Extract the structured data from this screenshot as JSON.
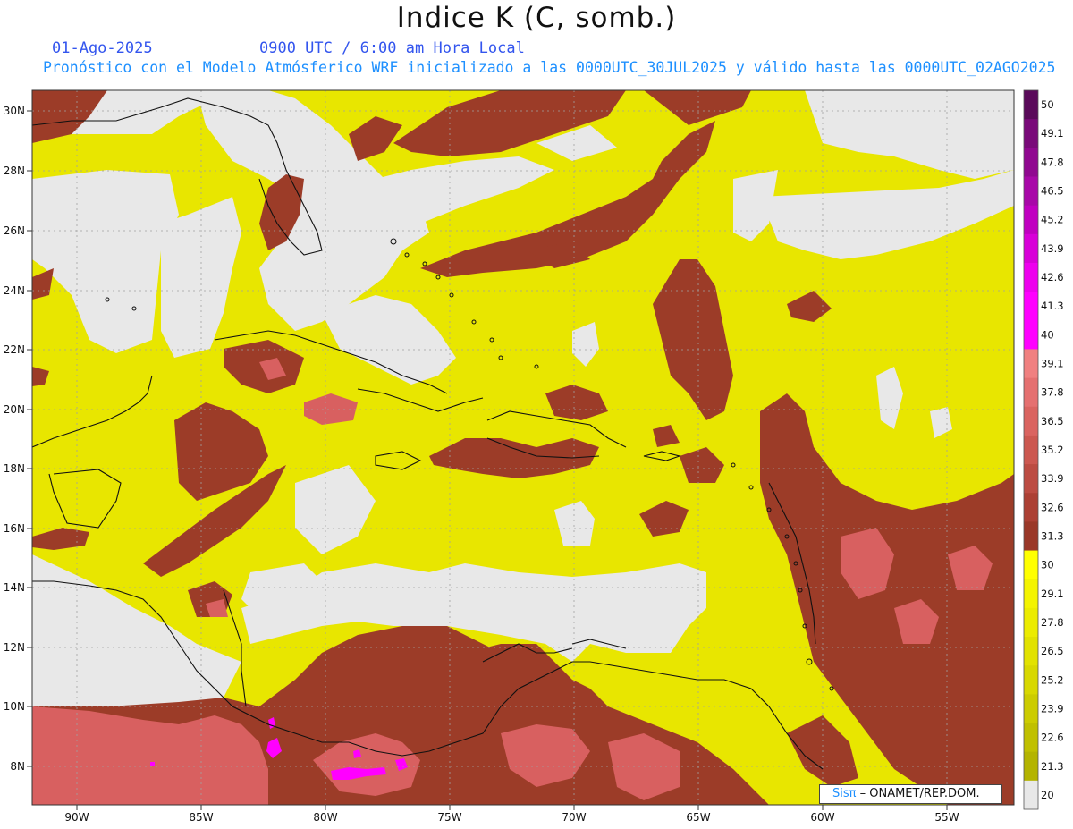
{
  "header": {
    "title": "Indice K (C, somb.)",
    "date": "01-Ago-2025",
    "time": "0900 UTC / 6:00 am Hora Local",
    "subtitle": "Pronóstico con el Modelo Atmósferico WRF inicializado a las 0000UTC_30JUL2025 y válido hasta las  0000UTC_02AGO2025"
  },
  "map": {
    "lat_labels": [
      "30N",
      "28N",
      "26N",
      "24N",
      "22N",
      "20N",
      "18N",
      "16N",
      "14N",
      "12N",
      "10N",
      "8N"
    ],
    "lon_labels": [
      "90W",
      "85W",
      "80W",
      "75W",
      "70W",
      "65W",
      "60W",
      "55W"
    ],
    "field_colors": {
      "below_20": "#e8e8e8",
      "band_20_30": "#e8e600",
      "band_30_37": "#9c3c28",
      "band_37_40": "#d86060",
      "band_40_plus": "#ff00ff"
    }
  },
  "colorbar": {
    "labels": [
      "50",
      "49.1",
      "47.8",
      "46.5",
      "45.2",
      "43.9",
      "42.6",
      "41.3",
      "40",
      "39.1",
      "37.8",
      "36.5",
      "35.2",
      "33.9",
      "32.6",
      "31.3",
      "30",
      "29.1",
      "27.8",
      "26.5",
      "25.2",
      "23.9",
      "22.6",
      "21.3",
      "20"
    ],
    "colors": [
      "#5a0a5a",
      "#7a0a7a",
      "#900890",
      "#a808a8",
      "#c000c0",
      "#d800d8",
      "#ee00ee",
      "#ff00ff",
      "#ff00ff",
      "#f08080",
      "#e57070",
      "#da6460",
      "#cc5850",
      "#bc4c42",
      "#ac4034",
      "#9a3828",
      "#ffff00",
      "#f4f400",
      "#ecec00",
      "#e2e200",
      "#d8d800",
      "#cccc00",
      "#c0c000",
      "#b4b400",
      "#e8e8e8"
    ]
  },
  "credit": {
    "logo": "Sisπ",
    "text": "– ONAMET/REP.DOM."
  }
}
